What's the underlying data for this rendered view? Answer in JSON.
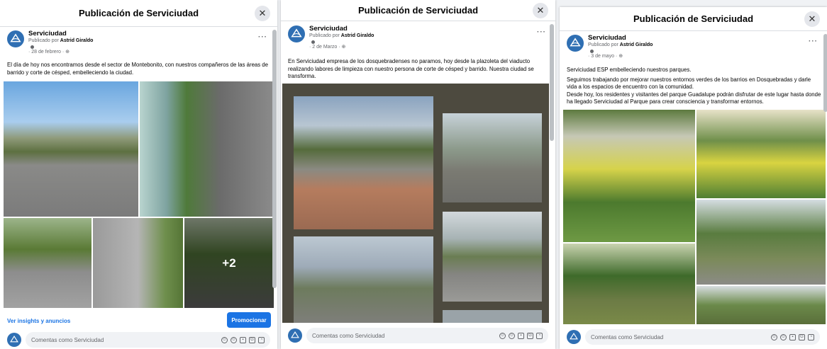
{
  "colors": {
    "brand_blue": "#1b74e4",
    "avatar_blue": "#2f6fb3",
    "dark_grid": "#4d4a3f"
  },
  "icons": {
    "close": "close-icon",
    "more": "more-options-icon",
    "globe": "globe-icon",
    "avatar": "serviciudad-logo"
  },
  "panels": [
    {
      "title": "Publicación de Serviciudad",
      "page_name": "Serviciudad",
      "posted_prefix": "Publicado por",
      "posted_by": "Astrid Giraldo",
      "date": "· 28 de febrero ·",
      "text": [
        "El día de hoy nos encontramos desde el sector de Montebonito, con nuestros compañeros de las áreas de barrido y corte de césped, embelleciendo la ciudad."
      ],
      "more_count": "+2",
      "insights": "Ver insights y anuncios",
      "promote": "Promocionar",
      "comment_placeholder": "Comentas como Serviciudad"
    },
    {
      "title": "Publicación de Serviciudad",
      "page_name": "Serviciudad",
      "posted_prefix": "Publicado por",
      "posted_by": "Astrid Giraldo",
      "date": "· 2 de Marzo ·",
      "text": [
        "En Serviciudad empresa de los dosquebradenses no paramos, hoy desde la plazoleta del viaducto realizando labores de limpieza con nuestro persona de corte de césped y barrido. Nuestra ciudad se transforma."
      ],
      "comment_placeholder": "Comentas como Serviciudad"
    },
    {
      "title": "Publicación de Serviciudad",
      "page_name": "Serviciudad",
      "posted_prefix": "Publicado por",
      "posted_by": "Astrid Giraldo",
      "date": "· 3 de mayo ·",
      "text": [
        "Serviciudad ESP embelleciendo nuestros parques.",
        "Seguimos trabajando por mejorar nuestros entornos verdes de los barrios en Dosquebradas y darle vida a los espacios de encuentro con la comunidad.",
        "Desde hoy, los residentes y visitantes del parque Guadalupe podrán disfrutar de este lugar hasta donde ha llegado Serviciudad al Parque para crear consciencia y transformar entornos."
      ],
      "comment_placeholder": "Comentas como Serviciudad"
    }
  ]
}
